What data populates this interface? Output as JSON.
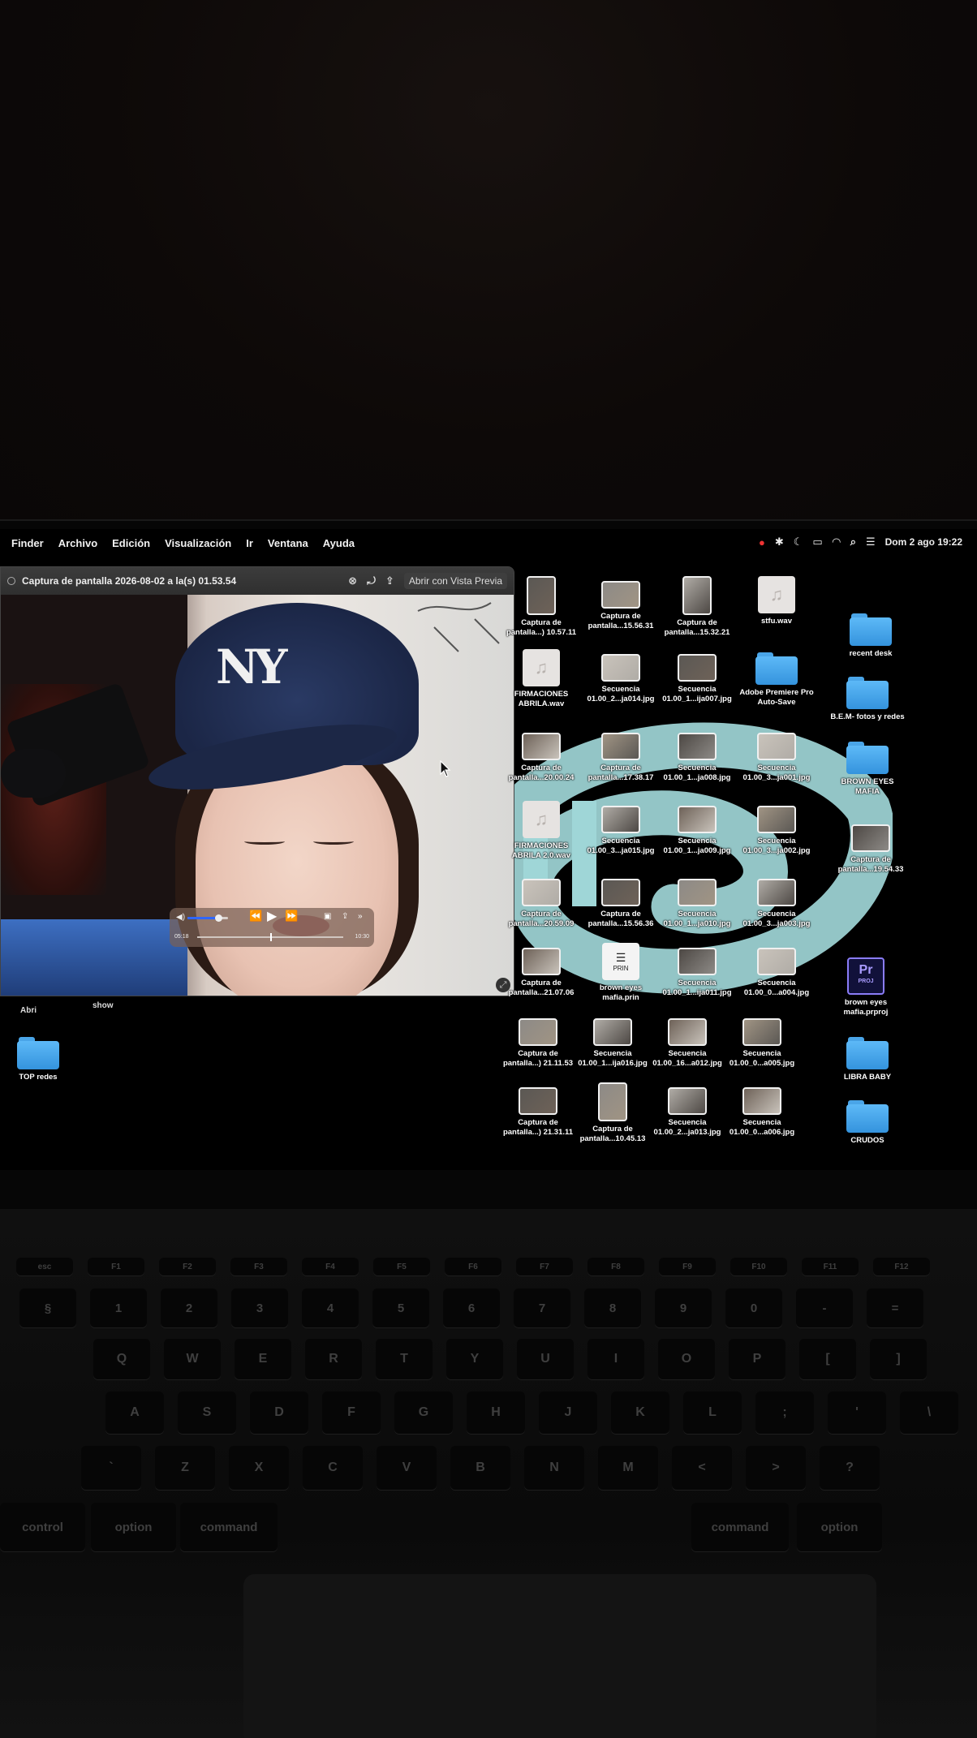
{
  "menubar": {
    "app": "Finder",
    "items": [
      "Archivo",
      "Edición",
      "Visualización",
      "Ir",
      "Ventana",
      "Ayuda"
    ],
    "clock": "Dom 2 ago  19:22",
    "status_icons": [
      "record-icon",
      "bluetooth-icon",
      "moon-icon",
      "battery-icon",
      "wifi-icon",
      "search-icon",
      "control-center-icon"
    ]
  },
  "quicklook": {
    "title": "Captura de pantalla 2026-08-02 a la(s) 01.53.54",
    "open_button": "Abrir con Vista Previa",
    "player": {
      "elapsed": "05:18",
      "remaining": "10:30",
      "volume_fraction": 0.75,
      "progress_fraction": 0.5
    }
  },
  "desktop_labels": {
    "abri": "Abri",
    "show": "show"
  },
  "desktop_icons": [
    {
      "label": "Captura de pantalla...) 10.57.11",
      "kind": "image"
    },
    {
      "label": "Captura de pantalla...15.56.31",
      "kind": "image"
    },
    {
      "label": "Captura de pantalla...15.32.21",
      "kind": "image"
    },
    {
      "label": "stfu.wav",
      "kind": "audio"
    },
    {
      "label": "recent desk",
      "kind": "folder"
    },
    {
      "label": "FIRMACIONES ABRILA.wav",
      "kind": "audio"
    },
    {
      "label": "Secuencia 01.00_2...ja014.jpg",
      "kind": "image"
    },
    {
      "label": "Secuencia 01.00_1...ija007.jpg",
      "kind": "image"
    },
    {
      "label": "Adobe Premiere Pro Auto-Save",
      "kind": "folder"
    },
    {
      "label": "B.E.M- fotos y redes",
      "kind": "folder"
    },
    {
      "label": "Captura de pantalla...20.00.24",
      "kind": "image"
    },
    {
      "label": "Captura de pantalla...17.38.17",
      "kind": "image"
    },
    {
      "label": "Secuencia 01.00_1...ja008.jpg",
      "kind": "image"
    },
    {
      "label": "Secuencia 01.00_3...ja001.jpg",
      "kind": "image"
    },
    {
      "label": "BROWN EYES MAFIA",
      "kind": "folder"
    },
    {
      "label": "FIRMACIONES ABRILA 2.0.wav",
      "kind": "audio"
    },
    {
      "label": "Secuencia 01.00_3...ja015.jpg",
      "kind": "image"
    },
    {
      "label": "Secuencia 01.00_1...ja009.jpg",
      "kind": "image"
    },
    {
      "label": "Secuencia 01.00_3...ja002.jpg",
      "kind": "image"
    },
    {
      "label": "Captura de pantalla...19.54.33",
      "kind": "image"
    },
    {
      "label": "Captura de pantalla...20.59.09",
      "kind": "image"
    },
    {
      "label": "Captura de pantalla...15.56.36",
      "kind": "image"
    },
    {
      "label": "Secuencia 01.00_1...ja010.jpg",
      "kind": "image"
    },
    {
      "label": "Secuencia 01.00_3...ja003.jpg",
      "kind": "image"
    },
    {
      "label": "Captura de pantalla...21.07.06",
      "kind": "image"
    },
    {
      "label": "brown eyes mafia.prin",
      "kind": "doc"
    },
    {
      "label": "Secuencia 01.00_1...ija011.jpg",
      "kind": "image"
    },
    {
      "label": "Secuencia 01.00_0...a004.jpg",
      "kind": "image"
    },
    {
      "label": "brown eyes mafia.prproj",
      "kind": "premiere"
    },
    {
      "label": "Captura de pantalla...) 21.11.53",
      "kind": "image"
    },
    {
      "label": "Secuencia 01.00_1...ija016.jpg",
      "kind": "image"
    },
    {
      "label": "Secuencia 01.00_16...a012.jpg",
      "kind": "image"
    },
    {
      "label": "Secuencia 01.00_0...a005.jpg",
      "kind": "image"
    },
    {
      "label": "LIBRA BABY",
      "kind": "folder"
    },
    {
      "label": "TOP redes",
      "kind": "folder"
    },
    {
      "label": "Captura de pantalla...) 21.31.11",
      "kind": "image"
    },
    {
      "label": "Captura de pantalla...10.45.13",
      "kind": "image"
    },
    {
      "label": "Secuencia 01.00_2...ja013.jpg",
      "kind": "image"
    },
    {
      "label": "Secuencia 01.00_0...a006.jpg",
      "kind": "image"
    },
    {
      "label": "CRUDOS",
      "kind": "folder"
    }
  ],
  "keyboard": {
    "row_fn": [
      "esc",
      "F1",
      "F2",
      "F3",
      "F4",
      "F5",
      "F6",
      "F7",
      "F8",
      "F9",
      "F10",
      "F11",
      "F12"
    ],
    "row_num": [
      "§",
      "1",
      "2",
      "3",
      "4",
      "5",
      "6",
      "7",
      "8",
      "9",
      "0",
      "-",
      "="
    ],
    "row_q": [
      "Q",
      "W",
      "E",
      "R",
      "T",
      "Y",
      "U",
      "I",
      "O",
      "P",
      "[",
      "]"
    ],
    "row_a": [
      "A",
      "S",
      "D",
      "F",
      "G",
      "H",
      "J",
      "K",
      "L",
      ";",
      "'",
      "\\"
    ],
    "row_z": [
      "`",
      "Z",
      "X",
      "C",
      "V",
      "B",
      "N",
      "M",
      "<",
      ">",
      "?"
    ],
    "row_mod": [
      "control",
      "option",
      "command",
      "command",
      "option"
    ]
  }
}
